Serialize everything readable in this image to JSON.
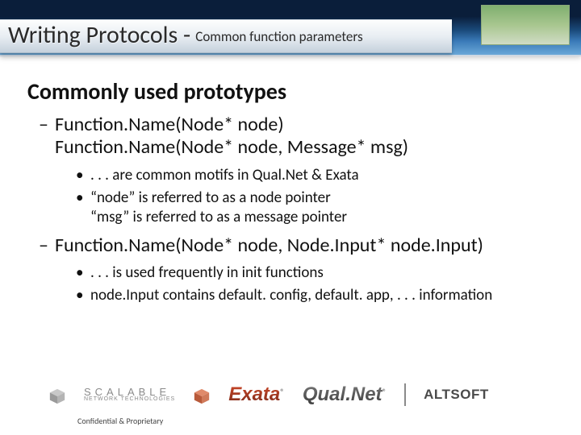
{
  "header": {
    "title_main": "Writing Protocols - ",
    "title_sub": "Common function parameters"
  },
  "content": {
    "heading": "Commonly used prototypes",
    "block1": {
      "line1": "Function.Name(Node* node)",
      "line2": "Function.Name(Node* node, Message* msg)",
      "sub1": ". . . are common motifs in Qual.Net & Exata",
      "sub2a": "“node” is referred to as a node pointer",
      "sub2b": "“msg” is referred to as a message pointer"
    },
    "block2": {
      "line1": "Function.Name(Node* node, Node.Input* node.Input)",
      "sub1": ". . . is used frequently in init functions",
      "sub2": "node.Input contains default. config, default. app, . . . information"
    }
  },
  "footer": {
    "scalable_main": "SCALABLE",
    "scalable_sub": "NETWORK TECHNOLOGIES",
    "exata": "Exata",
    "qualnet": "Qual.Net",
    "altsoft": "ALTSOFT",
    "confidential": "Confidential & Proprietary"
  }
}
